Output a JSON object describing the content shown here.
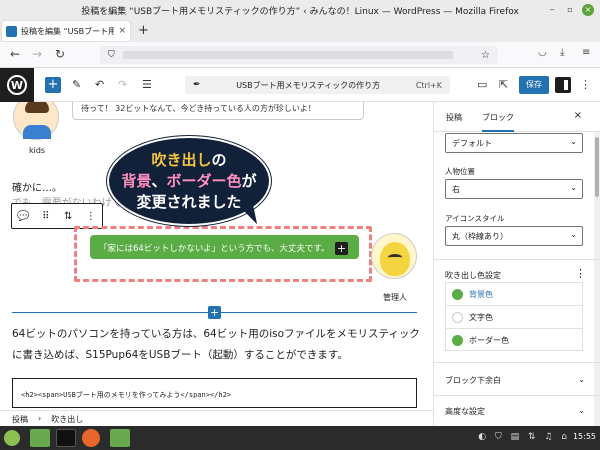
{
  "window": {
    "title": "投稿を編集 “USBブート用メモリスティックの作り方” ‹ みんなの！Linux — WordPress — Mozilla Firefox"
  },
  "browser": {
    "tab_label": "投稿を編集 “USBブート用メ",
    "tab_close": "×",
    "new_tab": "+"
  },
  "wp_toolbar": {
    "add_icon": "+",
    "doc_title": "USBブート用メモリスティックの作り方",
    "shortcut": "Ctrl+K",
    "save_label": "保存"
  },
  "editor": {
    "kids_bubble_text": "待って！ 32ビットなんて、今どき持っている人の方が珍しいよ！",
    "kids_name": "kids",
    "paragraph1": "確かに…。",
    "paragraph1_partial": "でも、需要がないわけでもないです。",
    "callout": {
      "line1_a": "吹き出し",
      "line1_b": "の",
      "line2_a": "背景",
      "line2_b": "、",
      "line2_c": "ボーダー色",
      "line2_d": "が",
      "line3": "変更されました"
    },
    "speech_text": "「家には64ビットしかないよ」という方でも、大丈夫です。",
    "admin_name": "管理人",
    "paragraph2": "64ビットのパソコンを持っている方は、64ビット用のisoファイルをメモリスティックに書き込めば、S15Pup64をUSBブート（起動）することができます。",
    "html_block": "<h2><span>USBブート用のメモリを作ってみよう</span></h2>"
  },
  "breadcrumb": {
    "item1": "投稿",
    "sep": "›",
    "item2": "吹き出し"
  },
  "sidebar": {
    "tab_post": "投稿",
    "tab_block": "ブロック",
    "close": "×",
    "style_value": "デフォルト",
    "position_label": "人物位置",
    "position_value": "右",
    "icon_style_label": "アイコンスタイル",
    "icon_style_value": "丸（枠線あり）",
    "color_section_title": "吹き出し色設定",
    "colors": [
      {
        "label": "背景色",
        "color": "#5aac44",
        "active": true
      },
      {
        "label": "文字色",
        "color": "#ffffff",
        "active": false
      },
      {
        "label": "ボーダー色",
        "color": "#5aac44",
        "active": false
      }
    ],
    "acc1": "ブロック下余白",
    "acc2": "高度な設定"
  },
  "taskbar": {
    "clock": "15:55"
  },
  "colors": {
    "accent": "#2271b1",
    "bubble_green": "#5aac44",
    "callout_bg": "#12213a",
    "dashed_border": "#f08080"
  }
}
